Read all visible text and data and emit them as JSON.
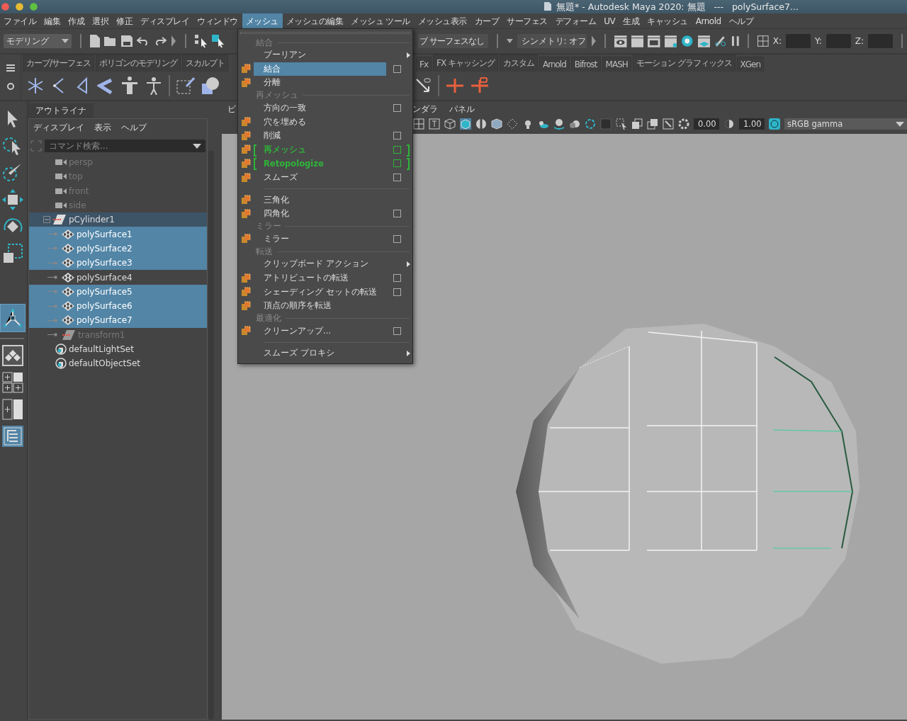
{
  "title_bar": {
    "title": "無題* - Autodesk Maya 2020: 無題   ---   polySurface7..."
  },
  "menu_bar": [
    {
      "label": "ファイル",
      "selected": false
    },
    {
      "label": "編集",
      "selected": false
    },
    {
      "label": "作成",
      "selected": false
    },
    {
      "label": "選択",
      "selected": false
    },
    {
      "label": "修正",
      "selected": false
    },
    {
      "label": "ディスプレイ",
      "selected": false
    },
    {
      "label": "ウィンドウ",
      "selected": false
    },
    {
      "label": "メッシュ",
      "selected": true
    },
    {
      "label": "メッシュの編集",
      "selected": false
    },
    {
      "label": "メッシュ ツール",
      "selected": false
    },
    {
      "label": "メッシュ表示",
      "selected": false
    },
    {
      "label": "カーブ",
      "selected": false
    },
    {
      "label": "サーフェス",
      "selected": false
    },
    {
      "label": "デフォーム",
      "selected": false
    },
    {
      "label": "UV",
      "selected": false
    },
    {
      "label": "生成",
      "selected": false
    },
    {
      "label": "キャッシュ",
      "selected": false
    },
    {
      "label": "Arnold",
      "selected": false
    },
    {
      "label": "ヘルプ",
      "selected": false
    }
  ],
  "status_line": {
    "workspace": "モデリング",
    "live_surface": "ブ サーフェスなし",
    "symmetry": "シンメトリ: オフ",
    "coordinates": [
      {
        "label": "X:"
      },
      {
        "label": "Y:"
      },
      {
        "label": "Z:"
      }
    ]
  },
  "shelf_tabs": [
    {
      "label": "カーブ/サーフェス"
    },
    {
      "label": "ポリゴンのモデリング"
    },
    {
      "label": "スカルプト"
    },
    {
      "label": "Fx"
    },
    {
      "label": "FX キャッシング"
    },
    {
      "label": "カスタム"
    },
    {
      "label": "Arnold"
    },
    {
      "label": "Bifrost"
    },
    {
      "label": "MASH"
    },
    {
      "label": "モーション グラフィックス"
    },
    {
      "label": "XGen"
    }
  ],
  "outliner": {
    "tab": "アウトライナ",
    "menus": [
      "ディスプレイ",
      "表示",
      "ヘルプ"
    ],
    "search": {
      "placeholder": "コマンド検索..."
    },
    "items": [
      {
        "kind": "camera",
        "label": "persp",
        "selected": false,
        "highlighted": false,
        "dimmed": true
      },
      {
        "kind": "camera",
        "label": "top",
        "selected": false,
        "highlighted": false,
        "dimmed": true
      },
      {
        "kind": "camera",
        "label": "front",
        "selected": false,
        "highlighted": false,
        "dimmed": true
      },
      {
        "kind": "camera",
        "label": "side",
        "selected": false,
        "highlighted": false,
        "dimmed": true
      },
      {
        "kind": "transform",
        "label": "pCylinder1",
        "selected": false,
        "highlighted": true,
        "dimmed": false,
        "expanded": true,
        "children": [
          {
            "kind": "mesh",
            "label": "polySurface1",
            "selected": true,
            "highlighted": false,
            "dimmed": false
          },
          {
            "kind": "mesh",
            "label": "polySurface2",
            "selected": true,
            "highlighted": false,
            "dimmed": false
          },
          {
            "kind": "mesh",
            "label": "polySurface3",
            "selected": true,
            "highlighted": false,
            "dimmed": false
          },
          {
            "kind": "mesh",
            "label": "polySurface4",
            "selected": false,
            "highlighted": false,
            "dimmed": false
          },
          {
            "kind": "mesh",
            "label": "polySurface5",
            "selected": true,
            "highlighted": false,
            "dimmed": false
          },
          {
            "kind": "mesh",
            "label": "polySurface6",
            "selected": true,
            "highlighted": false,
            "dimmed": false
          },
          {
            "kind": "mesh",
            "label": "polySurface7",
            "selected": true,
            "highlighted": false,
            "dimmed": false
          },
          {
            "kind": "transform",
            "label": "transform1",
            "selected": false,
            "highlighted": false,
            "dimmed": true
          }
        ]
      },
      {
        "kind": "set",
        "label": "defaultLightSet",
        "selected": false,
        "highlighted": false,
        "dimmed": false
      },
      {
        "kind": "set",
        "label": "defaultObjectSet",
        "selected": false,
        "highlighted": false,
        "dimmed": false
      }
    ]
  },
  "viewport": {
    "menus": [
      "ビ",
      "ンダラ",
      "パネル"
    ],
    "exposure": "0.00",
    "gamma": "1.00",
    "color_space": "sRGB gamma"
  },
  "open_menu": {
    "items": [
      {
        "kind": "section",
        "label": "結合"
      },
      {
        "kind": "item",
        "label": "ブーリアン",
        "icon": false,
        "selected": false,
        "option": false,
        "submenu": true,
        "marked": false
      },
      {
        "kind": "item",
        "label": "結合",
        "icon": true,
        "selected": true,
        "option": true,
        "submenu": false,
        "marked": false
      },
      {
        "kind": "item",
        "label": "分離",
        "icon": true,
        "selected": false,
        "option": false,
        "submenu": false,
        "marked": false
      },
      {
        "kind": "section",
        "label": "再メッシュ"
      },
      {
        "kind": "item",
        "label": "方向の一致",
        "icon": false,
        "selected": false,
        "option": true,
        "submenu": false,
        "marked": false
      },
      {
        "kind": "item",
        "label": "穴を埋める",
        "icon": true,
        "selected": false,
        "option": false,
        "submenu": false,
        "marked": false
      },
      {
        "kind": "item",
        "label": "削減",
        "icon": true,
        "selected": false,
        "option": true,
        "submenu": false,
        "marked": false
      },
      {
        "kind": "item",
        "label": "再メッシュ",
        "icon": true,
        "selected": false,
        "option": true,
        "submenu": false,
        "marked": true
      },
      {
        "kind": "item",
        "label": "Retopologize",
        "icon": true,
        "selected": false,
        "option": true,
        "submenu": false,
        "marked": true
      },
      {
        "kind": "item",
        "label": "スムーズ",
        "icon": true,
        "selected": false,
        "option": true,
        "submenu": false,
        "marked": false
      },
      {
        "kind": "separator"
      },
      {
        "kind": "item",
        "label": "三角化",
        "icon": true,
        "selected": false,
        "option": false,
        "submenu": false,
        "marked": false
      },
      {
        "kind": "item",
        "label": "四角化",
        "icon": true,
        "selected": false,
        "option": true,
        "submenu": false,
        "marked": false
      },
      {
        "kind": "section",
        "label": "ミラー"
      },
      {
        "kind": "item",
        "label": "ミラー",
        "icon": true,
        "selected": false,
        "option": true,
        "submenu": false,
        "marked": false
      },
      {
        "kind": "section",
        "label": "転送"
      },
      {
        "kind": "item",
        "label": "クリップボード アクション",
        "icon": false,
        "selected": false,
        "option": false,
        "submenu": true,
        "marked": false
      },
      {
        "kind": "item",
        "label": "アトリビュートの転送",
        "icon": true,
        "selected": false,
        "option": true,
        "submenu": false,
        "marked": false
      },
      {
        "kind": "item",
        "label": "シェーディング セットの転送",
        "icon": true,
        "selected": false,
        "option": true,
        "submenu": false,
        "marked": false
      },
      {
        "kind": "item",
        "label": "頂点の順序を転送",
        "icon": true,
        "selected": false,
        "option": false,
        "submenu": false,
        "marked": false
      },
      {
        "kind": "section",
        "label": "最適化"
      },
      {
        "kind": "item",
        "label": "クリーンアップ...",
        "icon": true,
        "selected": false,
        "option": true,
        "submenu": false,
        "marked": false
      },
      {
        "kind": "separator"
      },
      {
        "kind": "item",
        "label": "スムーズ プロキシ",
        "icon": false,
        "selected": false,
        "option": false,
        "submenu": true,
        "marked": false
      }
    ]
  }
}
